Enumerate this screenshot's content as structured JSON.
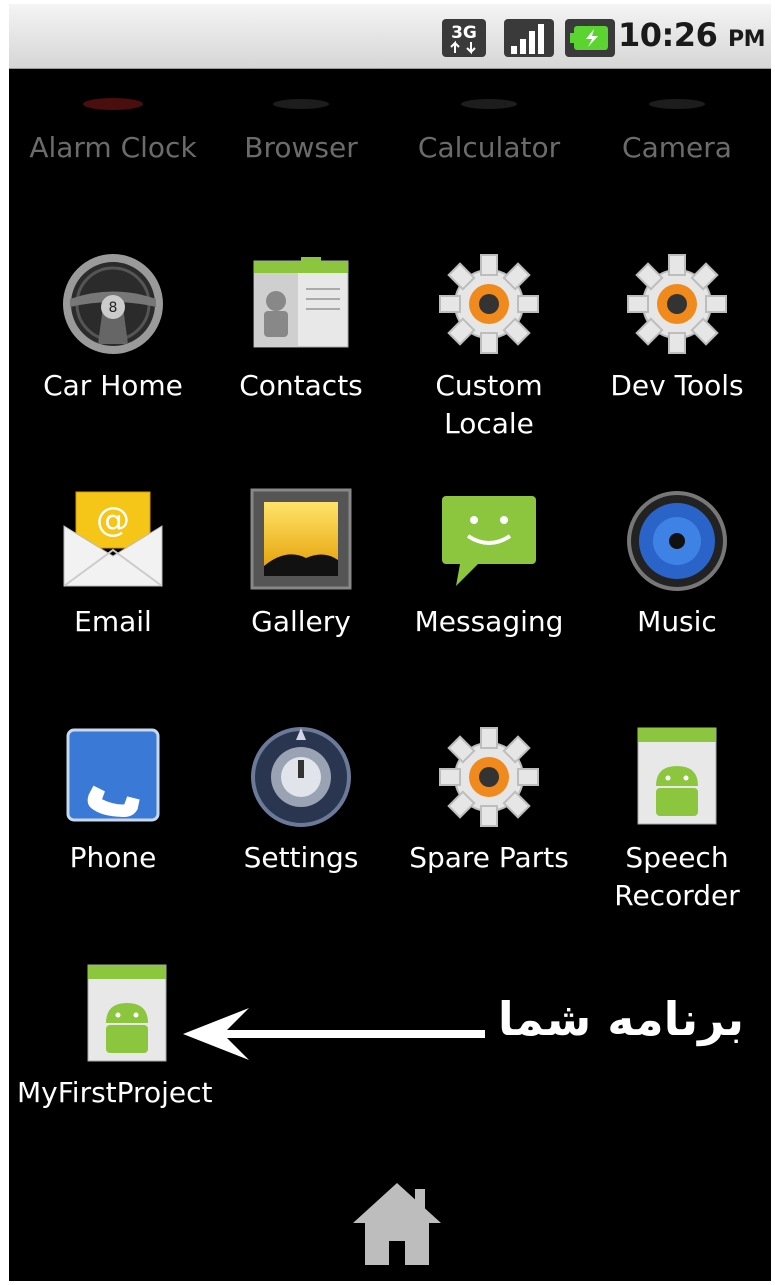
{
  "status_bar": {
    "time": "10:26",
    "ampm": "PM",
    "network_type": "3G",
    "icons": [
      "3g-data-icon",
      "signal-strength-icon",
      "battery-charging-icon"
    ]
  },
  "apps": [
    {
      "label": "Alarm Clock",
      "icon": "alarm-clock-icon"
    },
    {
      "label": "Browser",
      "icon": "browser-icon"
    },
    {
      "label": "Calculator",
      "icon": "calculator-icon"
    },
    {
      "label": "Camera",
      "icon": "camera-icon"
    },
    {
      "label": "Car Home",
      "icon": "steering-wheel-icon"
    },
    {
      "label": "Contacts",
      "icon": "contacts-book-icon"
    },
    {
      "label": "Custom\nLocale",
      "icon": "gear-icon"
    },
    {
      "label": "Dev Tools",
      "icon": "gear-icon"
    },
    {
      "label": "Email",
      "icon": "envelope-icon"
    },
    {
      "label": "Gallery",
      "icon": "picture-frame-icon"
    },
    {
      "label": "Messaging",
      "icon": "speech-bubble-icon"
    },
    {
      "label": "Music",
      "icon": "speaker-icon"
    },
    {
      "label": "Phone",
      "icon": "phone-handset-icon"
    },
    {
      "label": "Settings",
      "icon": "settings-knob-icon"
    },
    {
      "label": "Spare Parts",
      "icon": "gear-icon"
    },
    {
      "label": "Speech\nRecorder",
      "icon": "android-default-icon"
    },
    {
      "label": "MyFirstProject",
      "icon": "android-default-icon"
    }
  ],
  "annotation": {
    "text": "برنامه شما",
    "arrow": "left-arrow-icon"
  },
  "nav": {
    "home_icon": "home-icon"
  },
  "colors": {
    "background": "#000000",
    "label": "#ffffff",
    "status_bar": "#e4e4e4",
    "android_green": "#8cc63f",
    "gear_orange": "#f08a1c"
  }
}
